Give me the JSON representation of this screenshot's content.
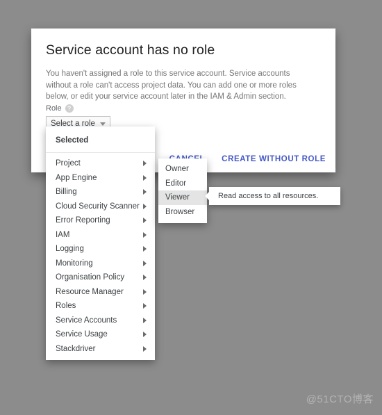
{
  "background_color": "#8c8c8c",
  "accent_color": "#4458c4",
  "dialog": {
    "title": "Service account has no role",
    "body": "You haven't assigned a role to this service account. Service accounts without a role can't access project data. You can add one or more roles below, or edit your service account later in the IAM & Admin section.",
    "role_label": "Role",
    "help_icon_glyph": "?",
    "role_select_value": "Select a role",
    "actions": [
      {
        "label": "CANCEL",
        "name": "cancel-button"
      },
      {
        "label": "CREATE WITHOUT ROLE",
        "name": "create-without-role-button"
      }
    ]
  },
  "role_menu": {
    "section_header": "Selected",
    "items": [
      {
        "label": "Project"
      },
      {
        "label": "App Engine"
      },
      {
        "label": "Billing"
      },
      {
        "label": "Cloud Security Scanner"
      },
      {
        "label": "Error Reporting"
      },
      {
        "label": "IAM"
      },
      {
        "label": "Logging"
      },
      {
        "label": "Monitoring"
      },
      {
        "label": "Organisation Policy"
      },
      {
        "label": "Resource Manager"
      },
      {
        "label": "Roles"
      },
      {
        "label": "Service Accounts"
      },
      {
        "label": "Service Usage"
      },
      {
        "label": "Stackdriver"
      }
    ]
  },
  "role_submenu": {
    "items": [
      {
        "label": "Owner",
        "selected": false
      },
      {
        "label": "Editor",
        "selected": false
      },
      {
        "label": "Viewer",
        "selected": true
      },
      {
        "label": "Browser",
        "selected": false
      }
    ]
  },
  "tooltip": {
    "text": "Read access to all resources."
  },
  "watermark": {
    "text": "@51CTO博客"
  }
}
